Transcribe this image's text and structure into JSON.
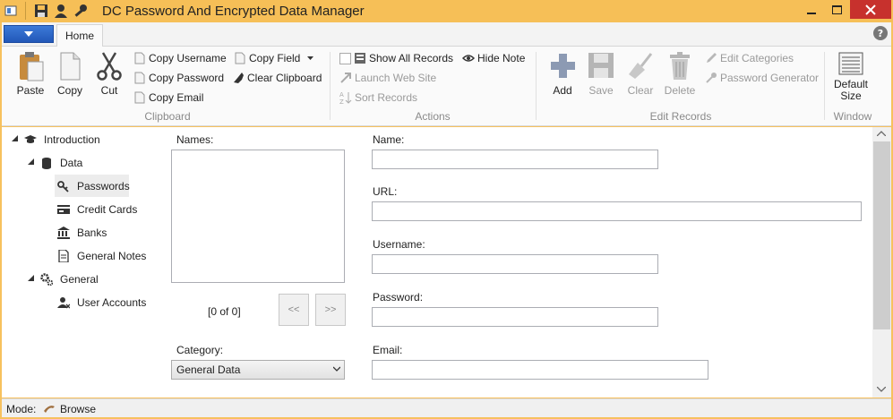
{
  "window": {
    "title": "DC Password And Encrypted Data Manager",
    "accent": "#f6bf57"
  },
  "tabs": {
    "home": "Home"
  },
  "ribbon": {
    "clipboard": {
      "paste": "Paste",
      "copy": "Copy",
      "cut": "Cut",
      "copy_username": "Copy Username",
      "copy_password": "Copy Password",
      "copy_email": "Copy Email",
      "copy_field": "Copy Field",
      "clear_clipboard": "Clear Clipboard",
      "group": "Clipboard"
    },
    "actions": {
      "show_all_records": "Show All Records",
      "hide_note": "Hide Note",
      "launch_web_site": "Launch Web Site",
      "sort_records": "Sort Records",
      "group": "Actions"
    },
    "edit_records": {
      "add": "Add",
      "save": "Save",
      "clear": "Clear",
      "delete": "Delete",
      "edit_categories": "Edit Categories",
      "password_generator": "Password Generator",
      "group": "Edit Records"
    },
    "window": {
      "default_size_line1": "Default",
      "default_size_line2": "Size",
      "group": "Window"
    }
  },
  "tree": {
    "introduction": "Introduction",
    "data": "Data",
    "passwords": "Passwords",
    "credit_cards": "Credit Cards",
    "banks": "Banks",
    "general_notes": "General Notes",
    "general": "General",
    "user_accounts": "User Accounts"
  },
  "records": {
    "names_label": "Names:",
    "counter": "[0 of 0]",
    "prev": "<<",
    "next": ">>",
    "category_label": "Category:",
    "category_value": "General Data"
  },
  "form": {
    "name_label": "Name:",
    "url_label": "URL:",
    "username_label": "Username:",
    "password_label": "Password:",
    "email_label": "Email:",
    "name_value": "",
    "url_value": "",
    "username_value": "",
    "password_value": "",
    "email_value": ""
  },
  "status": {
    "mode_label": "Mode:",
    "mode_value": "Browse"
  }
}
